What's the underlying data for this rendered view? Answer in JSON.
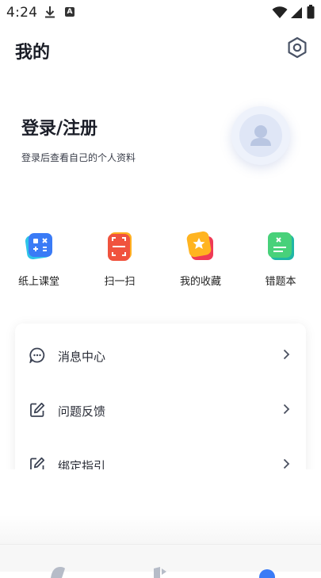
{
  "status": {
    "time": "4:24"
  },
  "header": {
    "title": "我的"
  },
  "profile": {
    "login_title": "登录/注册",
    "login_subtitle": "登录后查看自己的个人资料"
  },
  "quick_actions": [
    {
      "label": "纸上课堂",
      "icon": "paper-classroom-icon",
      "color": "#3a8ef6"
    },
    {
      "label": "扫一扫",
      "icon": "scan-icon",
      "color": "#f25a3d"
    },
    {
      "label": "我的收藏",
      "icon": "favorites-icon",
      "color": "#f7a42b"
    },
    {
      "label": "错题本",
      "icon": "mistake-book-icon",
      "color": "#2fbf8f"
    }
  ],
  "menu": [
    {
      "label": "消息中心",
      "icon": "message-icon"
    },
    {
      "label": "问题反馈",
      "icon": "feedback-icon"
    },
    {
      "label": "绑定指引",
      "icon": "binding-guide-icon"
    }
  ],
  "colors": {
    "accent": "#3a7bf6",
    "text": "#1f2430"
  }
}
